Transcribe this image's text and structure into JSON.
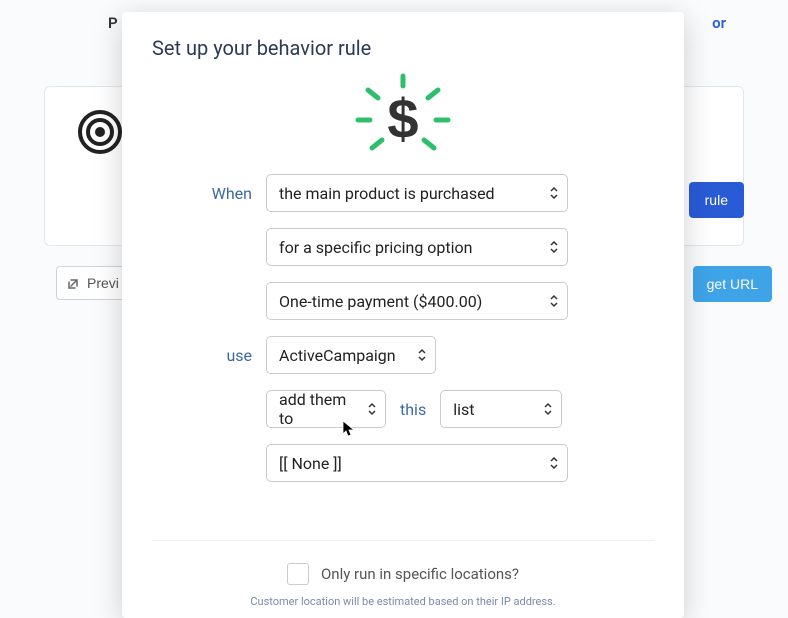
{
  "background": {
    "top_left": "P",
    "top_right": "or",
    "rule_button": "rule",
    "preview_button": "Previ",
    "get_url_button": "get URL"
  },
  "modal": {
    "title": "Set up your behavior rule",
    "labels": {
      "when": "When",
      "use": "use",
      "this": "this"
    },
    "selects": {
      "trigger": "the main product is purchased",
      "condition": "for a specific pricing option",
      "pricing": "One-time payment ($400.00)",
      "integration": "ActiveCampaign",
      "action": "add them to",
      "target_type": "list",
      "target_value": "[[ None ]]"
    },
    "footer": {
      "checkbox_label": "Only run in specific locations?",
      "note": "Customer location will be estimated based on their IP address."
    },
    "icons": {
      "hero": "dollar-sparkle-icon",
      "bg_target": "target-icon",
      "external": "external-link-icon",
      "cursor": "cursor-icon"
    }
  }
}
